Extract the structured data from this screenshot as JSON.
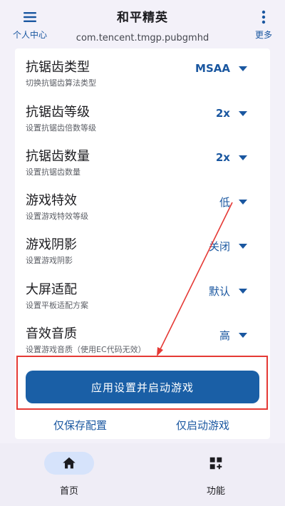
{
  "header": {
    "menu_label": "个人中心",
    "title": "和平精英",
    "package": "com.tencent.tmgp.pubgmhd",
    "more_label": "更多"
  },
  "settings": [
    {
      "title": "抗锯齿类型",
      "desc": "切换抗锯齿算法类型",
      "value": "MSAA"
    },
    {
      "title": "抗锯齿等级",
      "desc": "设置抗锯齿倍数等级",
      "value": "2x"
    },
    {
      "title": "抗锯齿数量",
      "desc": "设置抗锯齿数量",
      "value": "2x"
    },
    {
      "title": "游戏特效",
      "desc": "设置游戏特效等级",
      "value": "低"
    },
    {
      "title": "游戏阴影",
      "desc": "设置游戏阴影",
      "value": "关闭"
    },
    {
      "title": "大屏适配",
      "desc": "设置平板适配方案",
      "value": "默认"
    },
    {
      "title": "音效音质",
      "desc": "设置游戏音质（使用EC代码无效）",
      "value": "高"
    }
  ],
  "actions": {
    "apply_launch": "应用设置并启动游戏",
    "save_only": "仅保存配置",
    "launch_only": "仅启动游戏"
  },
  "bottom_nav": {
    "home_label": "首页",
    "function_label": "功能"
  },
  "colors": {
    "accent": "#1a57a0",
    "primary_button": "#1a5fa6",
    "highlight": "#e53935",
    "background": "#f3f1f9"
  },
  "icons": {
    "menu": "hamburger-menu-icon",
    "more": "vertical-dots-icon",
    "dropdown": "caret-down-icon",
    "home": "home-icon",
    "function": "grid-plus-icon"
  }
}
